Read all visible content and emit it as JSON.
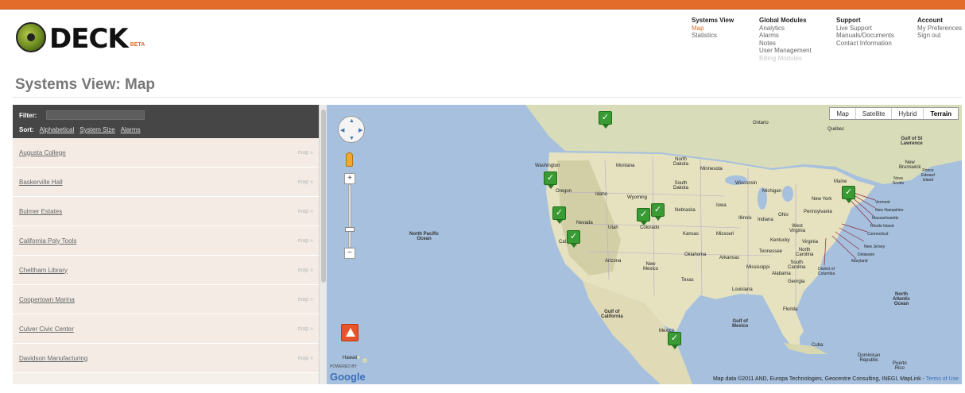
{
  "brand": {
    "name": "DECK",
    "badge": "BETA"
  },
  "nav": [
    {
      "heading": "Systems View",
      "items": [
        {
          "label": "Map",
          "state": "active"
        },
        {
          "label": "Statistics",
          "state": "normal"
        }
      ]
    },
    {
      "heading": "Global Modules",
      "items": [
        {
          "label": "Analytics",
          "state": "normal"
        },
        {
          "label": "Alarms",
          "state": "normal"
        },
        {
          "label": "Notes",
          "state": "normal"
        },
        {
          "label": "User Management",
          "state": "normal"
        },
        {
          "label": "Billing Modules",
          "state": "disabled"
        }
      ]
    },
    {
      "heading": "Support",
      "items": [
        {
          "label": "Live Support",
          "state": "normal"
        },
        {
          "label": "Manuals/Documents",
          "state": "normal"
        },
        {
          "label": "Contact Information",
          "state": "normal"
        }
      ]
    },
    {
      "heading": "Account",
      "items": [
        {
          "label": "My Preferences",
          "state": "normal"
        },
        {
          "label": "Sign out",
          "state": "normal"
        }
      ]
    }
  ],
  "page": {
    "title": "Systems View: Map"
  },
  "filter": {
    "label": "Filter:",
    "value": "",
    "sort_label": "Sort:",
    "sort_options": [
      "Alphabetical",
      "System Size",
      "Alarms"
    ]
  },
  "systems": [
    {
      "name": "Augusta College",
      "link": "map »"
    },
    {
      "name": "Baskerville Hall",
      "link": "map »"
    },
    {
      "name": "Bulmer Estates",
      "link": "map »"
    },
    {
      "name": "California Poly Tools",
      "link": "map »"
    },
    {
      "name": "Cheltham Library",
      "link": "map »"
    },
    {
      "name": "Coopertown Marina",
      "link": "map »"
    },
    {
      "name": "Culver Civic Center",
      "link": "map »"
    },
    {
      "name": "Davidson Manufacturing",
      "link": "map »"
    }
  ],
  "map": {
    "types": [
      {
        "label": "Map",
        "active": false
      },
      {
        "label": "Satellite",
        "active": false
      },
      {
        "label": "Hybrid",
        "active": false
      },
      {
        "label": "Terrain",
        "active": true
      }
    ],
    "powered_by": "POWERED BY",
    "google": "Google",
    "attribution": "Map data ©2011 AND, Europa Technologies, Geocentre Consulting, INEGI, MapLink -",
    "terms": "Terms of Use",
    "labels": {
      "ocean": "North Pacific\nOcean",
      "atlantic": "North\nAtlantic\nOcean",
      "gulf_ca": "Gulf of\nCalifornia",
      "gulf_mx": "Gulf of\nMexico",
      "gulf_stl": "Gulf of St\nLawrence",
      "hawaii": "Hawaii",
      "cuba": "Cuba",
      "dominican": "Dominican\nRepublic",
      "puerto": "Puerto\nRico",
      "ontario": "Ontario",
      "quebec": "Québec",
      "washington": "Washington",
      "oregon": "Oregon",
      "idaho": "Idaho",
      "montana": "Montana",
      "wyoming": "Wyoming",
      "nevada": "Nevada",
      "utah": "Utah",
      "colorado": "Colorado",
      "ca": "Cal",
      "arizona": "Arizona",
      "new_mexico": "New\nMexico",
      "texas": "Texas",
      "oklahoma": "Oklahoma",
      "kansas": "Kansas",
      "nebraska": "Nebraska",
      "south_dakota": "South\nDakota",
      "north_dakota": "North\nDakota",
      "minnesota": "Minnesota",
      "iowa": "Iowa",
      "missouri": "Missouri",
      "arkansas": "Arkansas",
      "louisiana": "Louisiana",
      "mississippi": "Mississippi",
      "alabama": "Alabama",
      "georgia": "Georgia",
      "florida": "Florida",
      "tennessee": "Tennessee",
      "kentucky": "Kentucky",
      "illinois": "Illinois",
      "indiana": "Indiana",
      "ohio": "Ohio",
      "michigan": "Michigan",
      "wisconsin": "Wisconsin",
      "pennsylvania": "Pennsylvania",
      "new_york": "New York",
      "west_virginia": "West\nVirginia",
      "virginia": "Virginia",
      "north_carolina": "North\nCarolina",
      "south_carolina": "South\nCarolina",
      "maine": "Maine",
      "new_brunswick": "New\nBrunswick",
      "nova_scotia": "Nova\nScotia",
      "pei": "Prince\nEdward\nIsland",
      "mexico": "Mexico",
      "vermont": "Vermont",
      "new_hampshire": "New Hampshire",
      "massachusetts": "Massachusetts",
      "rhode_island": "Rhode Island",
      "connecticut": "Connecticut",
      "new_jersey": "New Jersey",
      "delaware": "Delaware",
      "maryland": "Maryland",
      "dc": "District of\nColumbia"
    }
  },
  "colors": {
    "accent": "#e46c2a",
    "marker": "#3a9b34",
    "water": "#a6c0de",
    "land": "#e4e2c4"
  }
}
